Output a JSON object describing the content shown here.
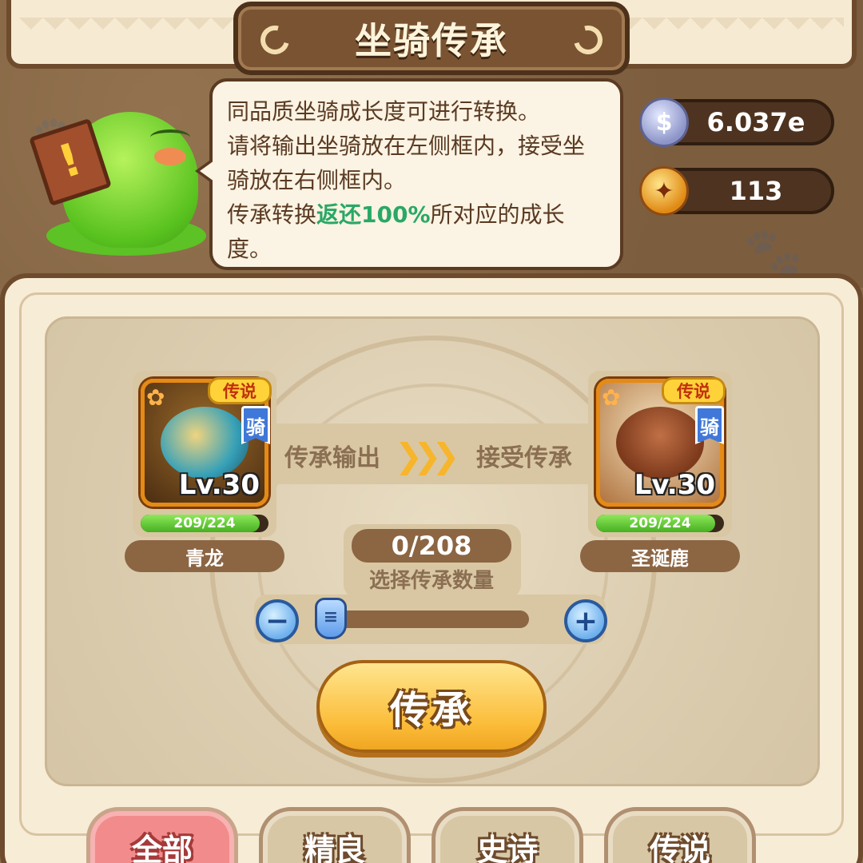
{
  "header": {
    "title": "坐骑传承"
  },
  "hint": {
    "line1": "同品质坐骑成长度可进行转换。",
    "line2": "请将输出坐骑放在左侧框内，接受坐骑放在右侧框内。",
    "line3_prefix": "传承转换",
    "line3_highlight": "返还100%",
    "line3_suffix": "所对应的成长度。",
    "highlight_color": "#29a866"
  },
  "currency": {
    "silver": {
      "icon": "silver-coin-icon",
      "glyph": "$",
      "value": "6.037e"
    },
    "gold": {
      "icon": "gold-medal-icon",
      "glyph": "✦",
      "value": "113"
    }
  },
  "output_mount": {
    "name": "青龙",
    "rarity": "传说",
    "type_tag": "骑",
    "level": "Lv.30",
    "growth": "209/224",
    "growth_fraction": 0.933
  },
  "receive_mount": {
    "name": "圣诞鹿",
    "rarity": "传说",
    "type_tag": "骑",
    "level": "Lv.30",
    "growth": "209/224",
    "growth_fraction": 0.933
  },
  "flow": {
    "output_label": "传承输出",
    "receive_label": "接受传承",
    "arrow_glyph": "❯❯❯"
  },
  "quantity": {
    "value": "0/208",
    "label": "选择传承数量",
    "slider_fraction": 0,
    "minus_glyph": "−",
    "plus_glyph": "+"
  },
  "confirm_label": "传承",
  "filter_tabs": [
    {
      "label": "全部",
      "active": true
    },
    {
      "label": "精良",
      "active": false
    },
    {
      "label": "史诗",
      "active": false
    },
    {
      "label": "传说",
      "active": false
    }
  ],
  "colors": {
    "accent_gold": "#fbbd3a",
    "panel_cream": "#f7ecd6",
    "frame_brown": "#6e4b2d",
    "active_tab": "#f28b8b"
  }
}
